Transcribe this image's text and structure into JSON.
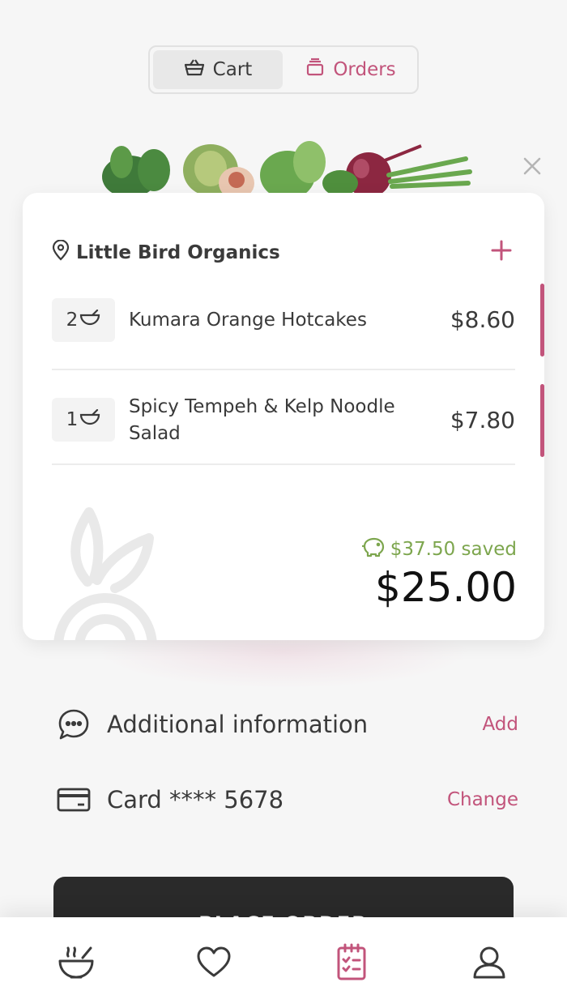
{
  "segmented": {
    "cart_label": "Cart",
    "orders_label": "Orders"
  },
  "cart": {
    "restaurant": "Little Bird Organics",
    "items": [
      {
        "qty": "2",
        "name": "Kumara Orange Hotcakes",
        "price": "$8.60"
      },
      {
        "qty": "1",
        "name_line1": "Spicy Tempeh & Kelp Noodle",
        "name_line2": "Salad",
        "price": "$7.80"
      }
    ],
    "saved": "$37.50 saved",
    "total": "$25.00"
  },
  "details": {
    "additional_label": "Additional information",
    "additional_action": "Add",
    "card_label": "Card **** 5678",
    "card_action": "Change"
  },
  "place_order": "PLACE ORDER",
  "colors": {
    "accent": "#c2547b",
    "saved_green": "#7da64e",
    "dark_button": "#2a2a2a"
  },
  "tabs": [
    "bowl-icon",
    "heart-icon",
    "orders-list-icon",
    "profile-icon"
  ]
}
